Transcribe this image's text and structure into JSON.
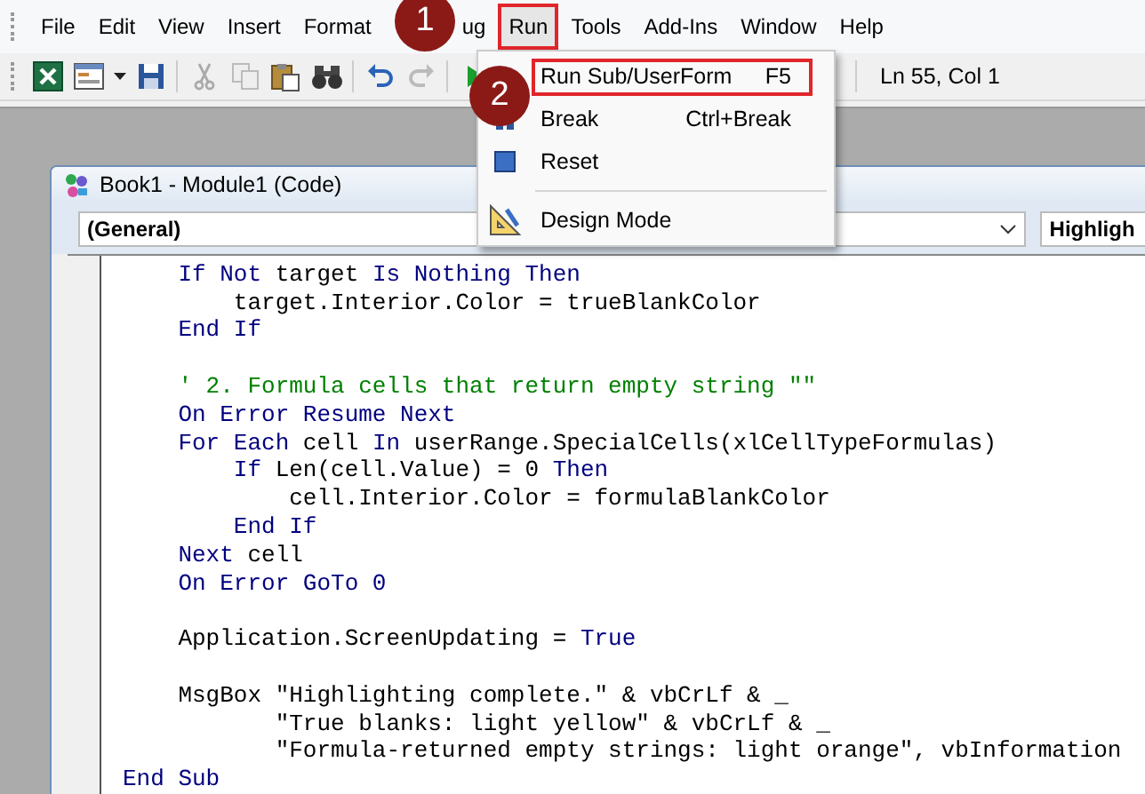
{
  "menubar": [
    {
      "label": "File",
      "highlighted": false
    },
    {
      "label": "Edit",
      "highlighted": false
    },
    {
      "label": "View",
      "highlighted": false
    },
    {
      "label": "Insert",
      "highlighted": false
    },
    {
      "label": "Format",
      "highlighted": false
    },
    {
      "label": "ug",
      "highlighted": false
    },
    {
      "label": "Run",
      "highlighted": true
    },
    {
      "label": "Tools",
      "highlighted": false
    },
    {
      "label": "Add-Ins",
      "highlighted": false
    },
    {
      "label": "Window",
      "highlighted": false
    },
    {
      "label": "Help",
      "highlighted": false
    }
  ],
  "toolbar": {
    "position": "Ln 55, Col 1"
  },
  "run_menu": [
    {
      "kind": "item",
      "label": "Run Sub/UserForm",
      "shortcut": "F5",
      "highlighted": true
    },
    {
      "kind": "item",
      "label": "Break",
      "shortcut": "Ctrl+Break",
      "highlighted": false
    },
    {
      "kind": "item",
      "label": "Reset",
      "highlighted": false
    },
    {
      "kind": "separator"
    },
    {
      "kind": "item",
      "label": "Design Mode",
      "highlighted": false
    }
  ],
  "steps": [
    "1",
    "2"
  ],
  "code_window": {
    "title": "Book1 - Module1 (Code)",
    "object_box": "(General)",
    "procedure_box": "Highligh",
    "lines": [
      {
        "kind": "code",
        "tokens": [
          {
            "kind": "keyword",
            "text": "    If Not"
          },
          {
            "kind": "plain",
            "text": " target "
          },
          {
            "kind": "keyword",
            "text": "Is Nothing Then"
          }
        ]
      },
      {
        "kind": "code",
        "tokens": [
          {
            "kind": "plain",
            "text": "        target.Interior.Color = trueBlankColor"
          }
        ]
      },
      {
        "kind": "code",
        "tokens": [
          {
            "kind": "keyword",
            "text": "    End If"
          }
        ]
      },
      {
        "kind": "blank"
      },
      {
        "kind": "code",
        "tokens": [
          {
            "kind": "comment",
            "text": "    ' 2. Formula cells that return empty string \"\""
          }
        ]
      },
      {
        "kind": "code",
        "tokens": [
          {
            "kind": "keyword",
            "text": "    On Error Resume Next"
          }
        ]
      },
      {
        "kind": "code",
        "tokens": [
          {
            "kind": "keyword",
            "text": "    For Each"
          },
          {
            "kind": "plain",
            "text": " cell "
          },
          {
            "kind": "keyword",
            "text": "In"
          },
          {
            "kind": "plain",
            "text": " userRange.SpecialCells(xlCellTypeFormulas)"
          }
        ]
      },
      {
        "kind": "code",
        "tokens": [
          {
            "kind": "keyword",
            "text": "        If"
          },
          {
            "kind": "plain",
            "text": " Len(cell.Value) = 0 "
          },
          {
            "kind": "keyword",
            "text": "Then"
          }
        ]
      },
      {
        "kind": "code",
        "tokens": [
          {
            "kind": "plain",
            "text": "            cell.Interior.Color = formulaBlankColor"
          }
        ]
      },
      {
        "kind": "code",
        "tokens": [
          {
            "kind": "keyword",
            "text": "        End If"
          }
        ]
      },
      {
        "kind": "code",
        "tokens": [
          {
            "kind": "keyword",
            "text": "    Next"
          },
          {
            "kind": "plain",
            "text": " cell"
          }
        ]
      },
      {
        "kind": "code",
        "tokens": [
          {
            "kind": "keyword",
            "text": "    On Error GoTo 0"
          }
        ]
      },
      {
        "kind": "blank"
      },
      {
        "kind": "code",
        "tokens": [
          {
            "kind": "plain",
            "text": "    Application.ScreenUpdating = "
          },
          {
            "kind": "keyword",
            "text": "True"
          }
        ]
      },
      {
        "kind": "blank"
      },
      {
        "kind": "code",
        "tokens": [
          {
            "kind": "plain",
            "text": "    MsgBox \"Highlighting complete.\" & vbCrLf & _"
          }
        ]
      },
      {
        "kind": "code",
        "tokens": [
          {
            "kind": "plain",
            "text": "           \"True blanks: light yellow\" & vbCrLf & _"
          }
        ]
      },
      {
        "kind": "code",
        "tokens": [
          {
            "kind": "plain",
            "text": "           \"Formula-returned empty strings: light orange\", vbInformation"
          }
        ]
      },
      {
        "kind": "code",
        "tokens": [
          {
            "kind": "keyword",
            "text": "End Sub"
          }
        ]
      }
    ]
  }
}
